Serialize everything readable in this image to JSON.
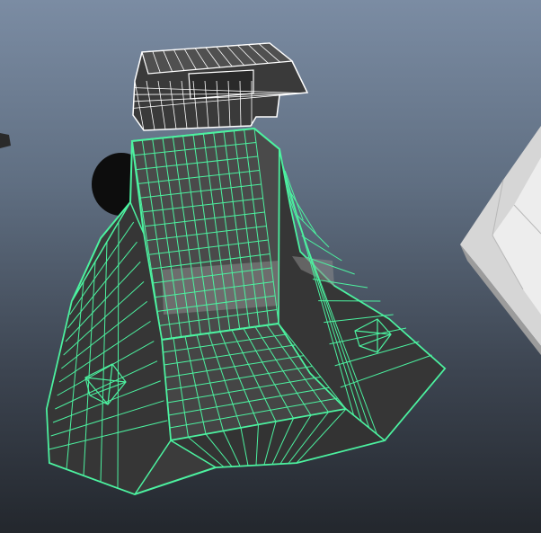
{
  "viewport": {
    "background_top": "#7b8ca3",
    "background_bottom": "#23272d"
  },
  "objects": [
    {
      "name": "top-box-mesh",
      "wire_color": "#ffffff",
      "fill_color": "#3a3a3a",
      "selected": false
    },
    {
      "name": "seat-mesh",
      "wire_color": "#4cf2a0",
      "fill_color": "#3b3b3b",
      "selected": true
    },
    {
      "name": "side-rock-mesh",
      "fill_color": "#c9c9c9",
      "selected": false
    },
    {
      "name": "left-edge-fragment",
      "fill_color": "#2a2a2a",
      "selected": false
    }
  ]
}
